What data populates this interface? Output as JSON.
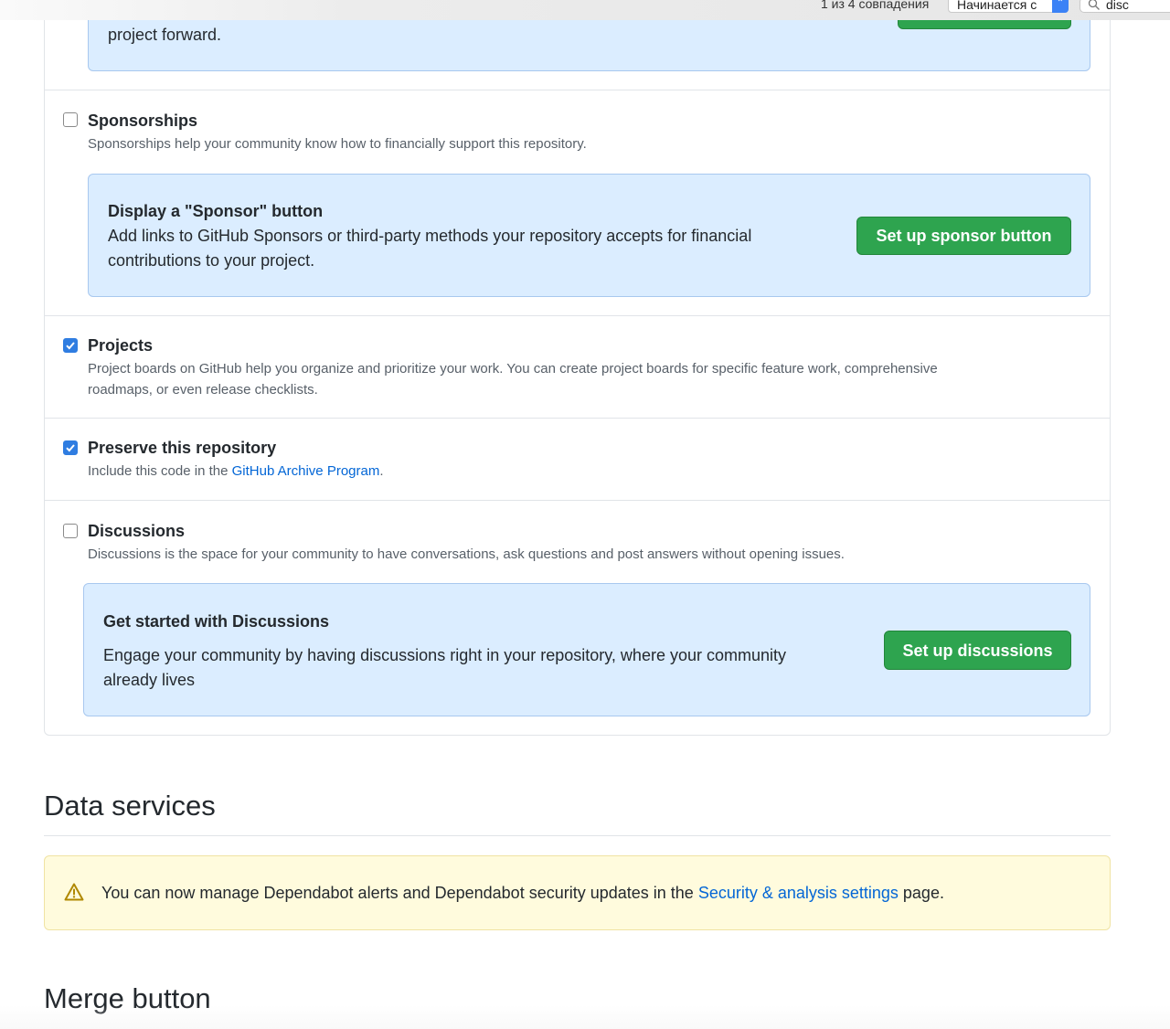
{
  "findbar": {
    "match_count": "1 из 4 совпадения",
    "mode": "Начинается с",
    "query": "disc"
  },
  "top_callout": {
    "text_tail": "project forward."
  },
  "sponsorships": {
    "title": "Sponsorships",
    "description": "Sponsorships help your community know how to financially support this repository.",
    "checked": false,
    "callout_title": "Display a \"Sponsor\" button",
    "callout_line1": "Add links to GitHub Sponsors or third-party methods your repository accepts for financial",
    "callout_line2": "contributions to your project.",
    "button": "Set up sponsor button"
  },
  "projects": {
    "title": "Projects",
    "description_line1": "Project boards on GitHub help you organize and prioritize your work. You can create project boards for specific feature work, comprehensive",
    "description_line2": "roadmaps, or even release checklists.",
    "checked": true
  },
  "preserve": {
    "title": "Preserve this repository",
    "description_prefix": "Include this code in the ",
    "link": "GitHub Archive Program",
    "description_suffix": ".",
    "checked": true
  },
  "discussions": {
    "title": "Discussions",
    "description": "Discussions is the space for your community to have conversations, ask questions and post answers without opening issues.",
    "checked": false,
    "callout_title": "Get started with Discussions",
    "callout_line1": "Engage your community by having discussions right in your repository, where your community",
    "callout_line2": "already lives",
    "button": "Set up discussions"
  },
  "data_services": {
    "heading": "Data services",
    "warning_prefix": "You can now manage Dependabot alerts and Dependabot security updates in the ",
    "warning_link": "Security & analysis settings",
    "warning_suffix": " page."
  },
  "merge_button": {
    "heading": "Merge button"
  },
  "colors": {
    "green_button": "#2ea44f",
    "callout_blue": "#dbedff",
    "link_blue": "#0366d6",
    "checkbox_blue": "#2f7de1",
    "warning_bg": "#fffbdd"
  }
}
